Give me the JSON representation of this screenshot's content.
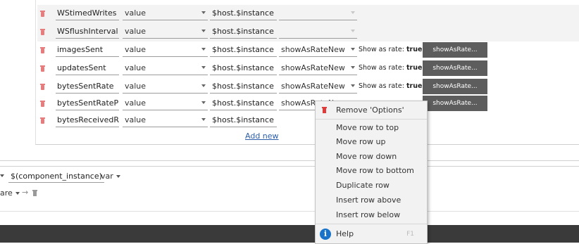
{
  "rows": [
    {
      "name": "WStimedWrites",
      "type": "value",
      "host": "$host.$instance",
      "option": "",
      "shaded": true,
      "rate_label": "",
      "rate_value": "",
      "rate_button": ""
    },
    {
      "name": "WSflushInterval",
      "type": "value",
      "host": "$host.$instance",
      "option": "",
      "shaded": true,
      "rate_label": "",
      "rate_value": "",
      "rate_button": ""
    },
    {
      "name": "imagesSent",
      "type": "value",
      "host": "$host.$instance",
      "option": "showAsRateNew",
      "shaded": false,
      "rate_label": "Show as rate:",
      "rate_value": "true",
      "rate_button": "showAsRate..."
    },
    {
      "name": "updatesSent",
      "type": "value",
      "host": "$host.$instance",
      "option": "showAsRateNew",
      "shaded": false,
      "rate_label": "Show as rate:",
      "rate_value": "true",
      "rate_button": "showAsRate..."
    },
    {
      "name": "bytesSentRate",
      "type": "value",
      "host": "$host.$instance",
      "option": "showAsRateNew",
      "shaded": false,
      "rate_label": "Show as rate:",
      "rate_value": "true",
      "rate_button": "showAsRate..."
    },
    {
      "name": "bytesSentRatePU",
      "type": "value",
      "host": "$host.$instance",
      "option": "showAsRateNew",
      "shaded": false,
      "rate_label": "",
      "rate_value": "",
      "rate_button": "showAsRate..."
    },
    {
      "name": "bytesReceivedRa",
      "type": "value",
      "host": "$host.$instance",
      "option": "",
      "shaded": false,
      "rate_label": "",
      "rate_value": "",
      "rate_button": ""
    }
  ],
  "add_new": "Add new",
  "bottom": {
    "instance_field": "$(component_instance)",
    "var_label": "var",
    "compare_label": "are",
    "arrow": "→"
  },
  "context_menu": {
    "remove": "Remove 'Options'",
    "items": [
      "Move row to top",
      "Move row up",
      "Move row down",
      "Move row to bottom",
      "Duplicate row",
      "Insert row above",
      "Insert row below"
    ],
    "help": "Help",
    "help_shortcut": "F1"
  },
  "icons": {
    "delete_row": "trash-icon",
    "help": "info-icon",
    "dropdown": "chevron-down-icon"
  },
  "colors": {
    "delete_icon": "#e87c7c",
    "rate_button_bg": "#5d5d5d",
    "link": "#2c5ea8",
    "help_icon": "#1a73c9",
    "footer": "#3a3a3a"
  }
}
